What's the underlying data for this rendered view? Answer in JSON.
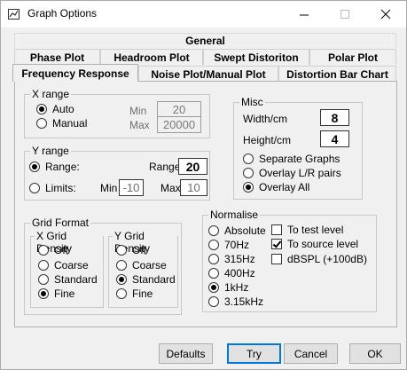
{
  "window": {
    "title": "Graph Options"
  },
  "tabs": {
    "general": "General",
    "row2": [
      "Phase Plot",
      "Headroom Plot",
      "Swept Distoriton",
      "Polar Plot"
    ],
    "row3": [
      "Frequency Response",
      "Noise Plot/Manual Plot",
      "Distortion Bar Chart"
    ],
    "selected": "Frequency Response"
  },
  "x_range": {
    "label": "X range",
    "auto_label": "Auto",
    "manual_label": "Manual",
    "selected": "Auto",
    "min_label": "Min",
    "max_label": "Max",
    "min_value": "20",
    "max_value": "20000"
  },
  "y_range": {
    "label": "Y range",
    "range_option": "Range:",
    "limits_option": "Limits:",
    "selected": "Range:",
    "range_label": "Range",
    "range_value": "20",
    "min_label": "Min",
    "min_value": "-10",
    "max_label": "Max",
    "max_value": "10"
  },
  "misc": {
    "label": "Misc",
    "width_label": "Width/cm",
    "width_value": "8",
    "height_label": "Height/cm",
    "height_value": "4",
    "separate_graphs": "Separate Graphs",
    "overlay_lr": "Overlay L/R pairs",
    "overlay_all": "Overlay All",
    "selected": "Overlay All"
  },
  "grid_format": {
    "label": "Grid Format",
    "x_density": {
      "label": "X Grid Density",
      "options": [
        "Off",
        "Coarse",
        "Standard",
        "Fine"
      ],
      "selected": "Fine"
    },
    "y_density": {
      "label": "Y Grid Density",
      "options": [
        "Off",
        "Coarse",
        "Standard",
        "Fine"
      ],
      "selected": "Standard"
    }
  },
  "normalise": {
    "label": "Normalise",
    "options": [
      "Absolute",
      "70Hz",
      "315Hz",
      "400Hz",
      "1kHz",
      "3.15kHz"
    ],
    "selected": "1kHz",
    "to_test_level": {
      "label": "To test level",
      "checked": false
    },
    "to_source_level": {
      "label": "To source level",
      "checked": true
    },
    "dbspl": {
      "label": "dBSPL (+100dB)",
      "checked": false
    }
  },
  "buttons": {
    "defaults": "Defaults",
    "try": "Try",
    "cancel": "Cancel",
    "ok": "OK"
  },
  "colors": {
    "accent": "#0078d7",
    "background": "#f0f0f0"
  }
}
